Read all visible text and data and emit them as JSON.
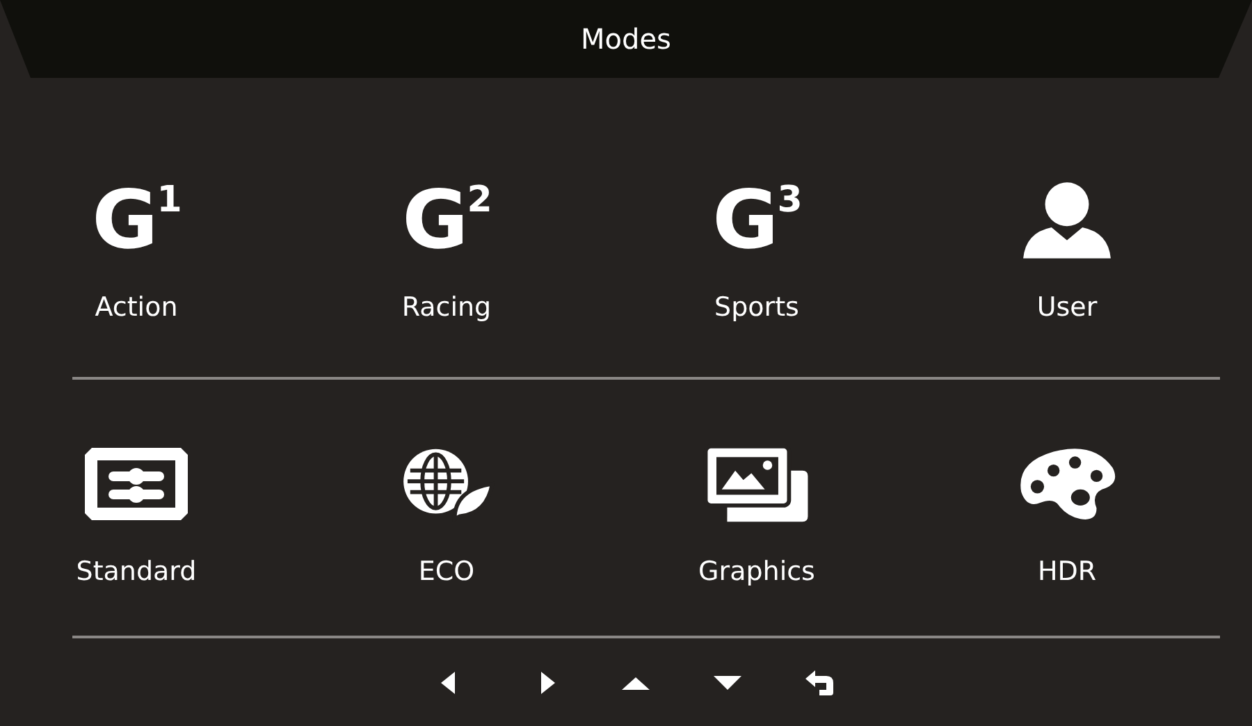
{
  "window": {
    "title": "Modes"
  },
  "mode_rows": [
    {
      "modes": [
        {
          "kind": "badge",
          "badge": "G$^{1}$",
          "label": "Action"
        },
        {
          "kind": "badge",
          "badge": "G$^{2}$",
          "label": "Racing"
        },
        {
          "kind": "badge",
          "badge": "G$^{3}$",
          "label": "Sports"
        },
        {
          "kind": "user",
          "label": "User"
        }
      ]
    },
    {
      "modes": [
        {
          "kind": "sliders",
          "label": "Standard"
        },
        {
          "kind": "eco",
          "label": "ECO"
        },
        {
          "kind": "pictures",
          "label": "Graphics"
        },
        {
          "kind": "palette",
          "label": "HDR"
        }
      ]
    }
  ],
  "nav_buttons": [
    {
      "kind": "left"
    },
    {
      "kind": "right"
    },
    {
      "kind": "up"
    },
    {
      "kind": "down"
    },
    {
      "kind": "back"
    }
  ]
}
